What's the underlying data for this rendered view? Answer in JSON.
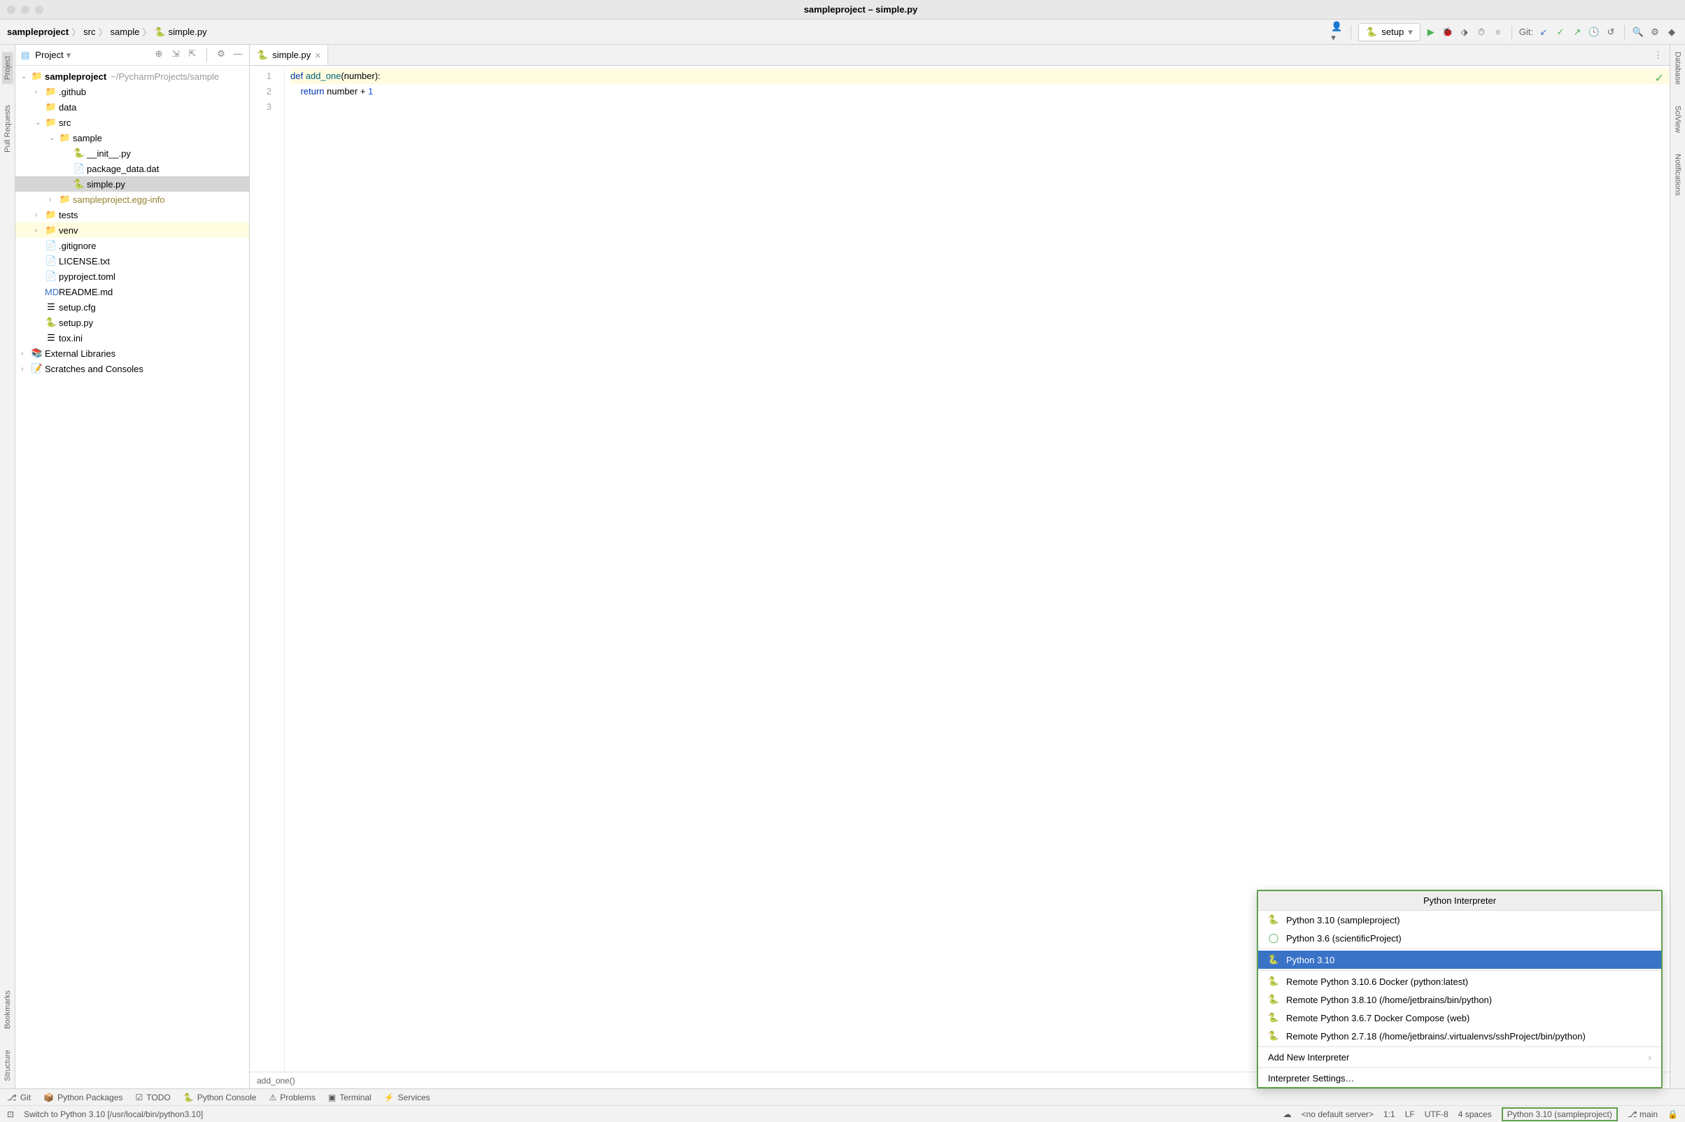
{
  "window": {
    "title": "sampleproject – simple.py"
  },
  "breadcrumbs": [
    "sampleproject",
    "src",
    "sample",
    "simple.py"
  ],
  "run_config": {
    "label": "setup"
  },
  "toolbar": {
    "git_label": "Git:"
  },
  "left_stripe": [
    "Project",
    "Pull Requests",
    "Bookmarks",
    "Structure"
  ],
  "right_stripe": [
    "Database",
    "SciView",
    "Notifications"
  ],
  "project_panel": {
    "title": "Project"
  },
  "tree": {
    "root": {
      "name": "sampleproject",
      "path": "~/PycharmProjects/sample"
    },
    "github": ".github",
    "data": "data",
    "src": "src",
    "sample": "sample",
    "init": "__init__.py",
    "pkgdat": "package_data.dat",
    "simple": "simple.py",
    "egg": "sampleproject.egg-info",
    "tests": "tests",
    "venv": "venv",
    "gitignore": ".gitignore",
    "license": "LICENSE.txt",
    "pyproject": "pyproject.toml",
    "readme": "README.md",
    "setupcfg": "setup.cfg",
    "setuppy": "setup.py",
    "toxini": "tox.ini",
    "extlib": "External Libraries",
    "scratch": "Scratches and Consoles"
  },
  "editor": {
    "tab": "simple.py",
    "gutter": [
      "1",
      "2",
      "3"
    ],
    "line1": {
      "def": "def ",
      "fn": "add_one",
      "rest": "(number):"
    },
    "line2": {
      "indent": "    ",
      "ret": "return ",
      "rest": "number + ",
      "num": "1"
    },
    "breadcrumb": "add_one()"
  },
  "interpreter_popup": {
    "title": "Python Interpreter",
    "items": [
      "Python 3.10 (sampleproject)",
      "Python 3.6 (scientificProject)",
      "Python 3.10",
      "Remote Python 3.10.6 Docker (python:latest)",
      "Remote Python 3.8.10 (/home/jetbrains/bin/python)",
      "Remote Python 3.6.7 Docker Compose (web)",
      "Remote Python 2.7.18 (/home/jetbrains/.virtualenvs/sshProject/bin/python)"
    ],
    "add_new": "Add New Interpreter",
    "settings": "Interpreter Settings…"
  },
  "bottom_toolbar": {
    "git": "Git",
    "packages": "Python Packages",
    "todo": "TODO",
    "console": "Python Console",
    "problems": "Problems",
    "terminal": "Terminal",
    "services": "Services"
  },
  "status": {
    "message": "Switch to Python 3.10 [/usr/local/bin/python3.10]",
    "server": "<no default server>",
    "position": "1:1",
    "line_ending": "LF",
    "encoding": "UTF-8",
    "indent": "4 spaces",
    "interpreter": "Python 3.10 (sampleproject)",
    "branch": "main"
  }
}
